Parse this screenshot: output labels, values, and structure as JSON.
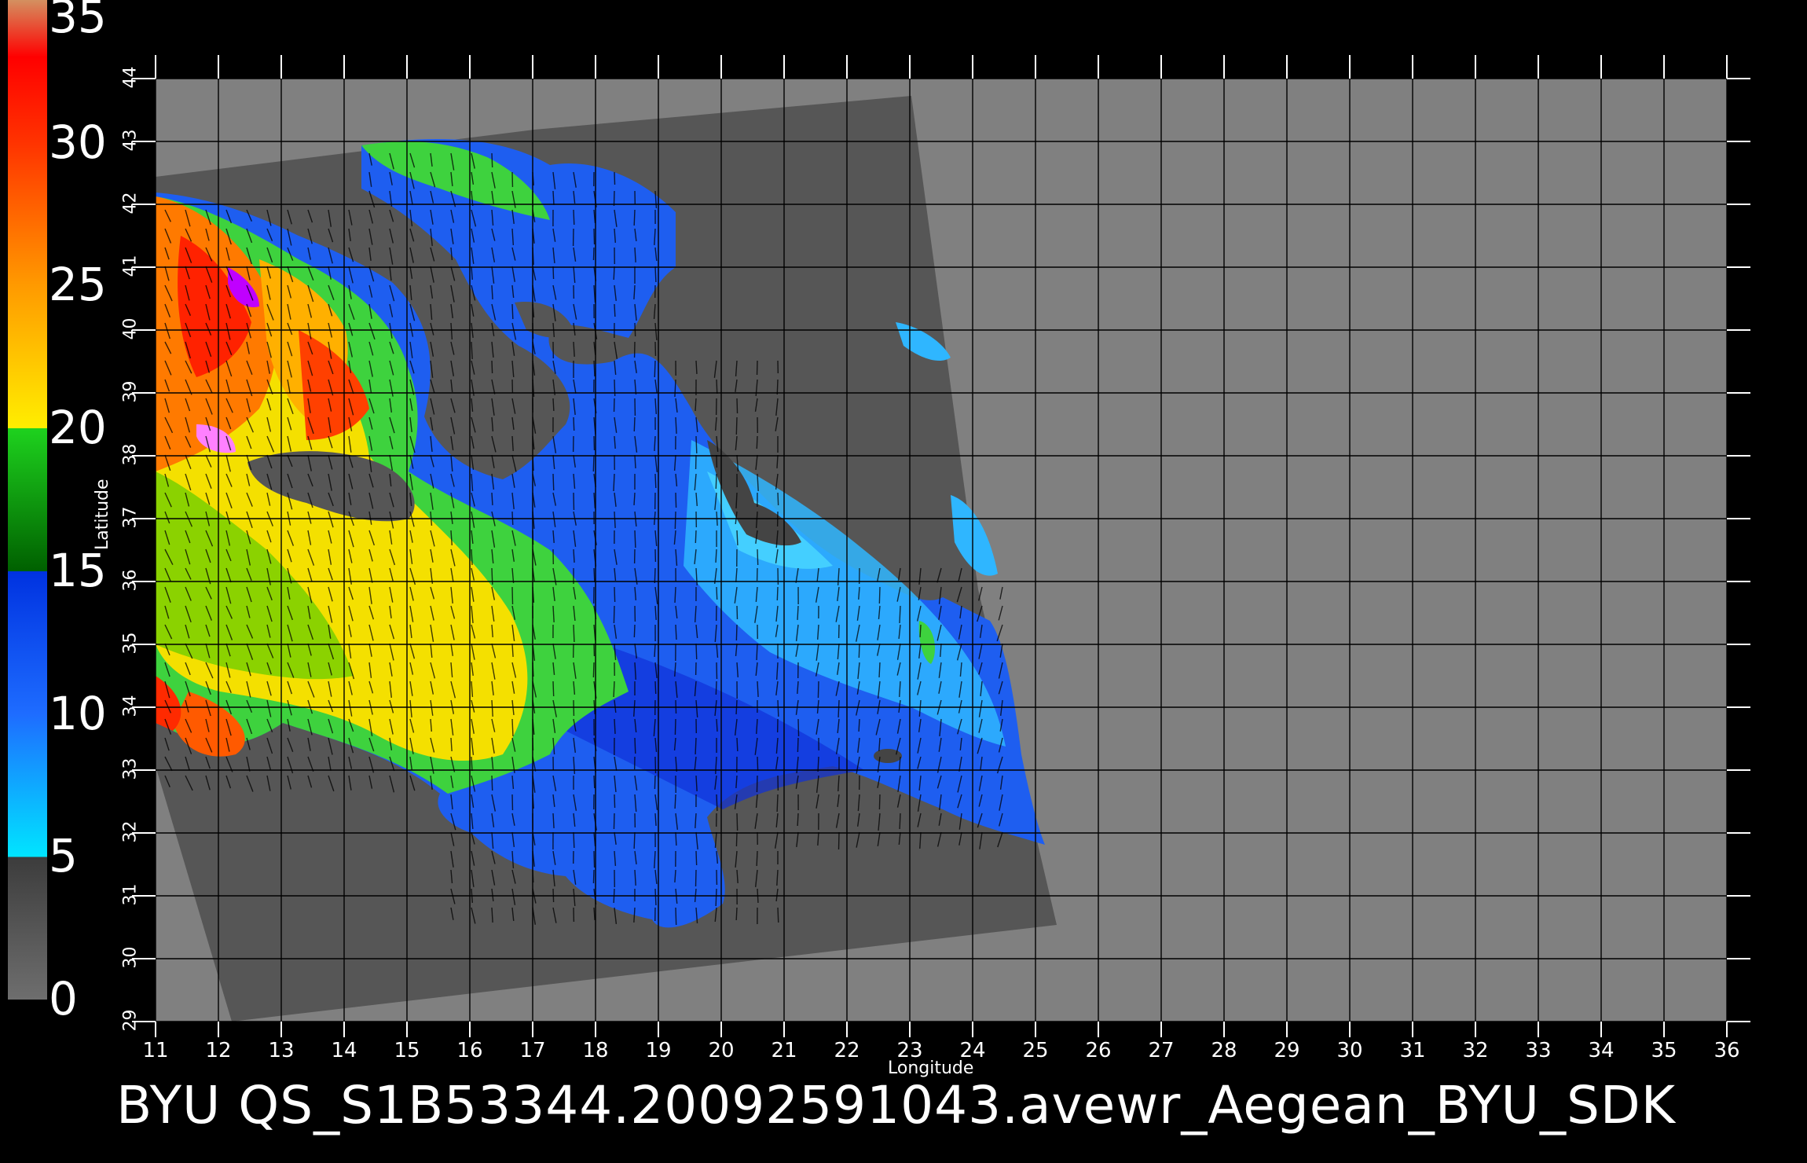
{
  "colorbar": {
    "labels": [
      "35",
      "30",
      "25",
      "20",
      "15",
      "10",
      "5",
      "0"
    ],
    "stops": [
      {
        "value": 0,
        "color": "#6e6e6e"
      },
      {
        "value": 5,
        "color": "#3c3c3c"
      },
      {
        "value": 5,
        "color": "#00e5ff"
      },
      {
        "value": 10,
        "color": "#1e6cff"
      },
      {
        "value": 15,
        "color": "#0032e0"
      },
      {
        "value": 15,
        "color": "#006000"
      },
      {
        "value": 20,
        "color": "#1ed21e"
      },
      {
        "value": 20,
        "color": "#ffee00"
      },
      {
        "value": 25,
        "color": "#ff9a00"
      },
      {
        "value": 30,
        "color": "#ff3300"
      },
      {
        "value": 33,
        "color": "#ff0000"
      },
      {
        "value": 35,
        "color": "#d49060"
      }
    ]
  },
  "axes": {
    "xlabel": "Longitude",
    "ylabel": "Latitude",
    "xlim": [
      11,
      36
    ],
    "ylim": [
      29,
      44
    ],
    "x_ticks": [
      "11",
      "12",
      "13",
      "14",
      "15",
      "16",
      "17",
      "18",
      "19",
      "20",
      "21",
      "22",
      "23",
      "24",
      "25",
      "26",
      "27",
      "28",
      "29",
      "30",
      "31",
      "32",
      "33",
      "34",
      "35",
      "36"
    ],
    "y_ticks": [
      "29",
      "30",
      "31",
      "32",
      "33",
      "34",
      "35",
      "36",
      "37",
      "38",
      "39",
      "40",
      "41",
      "42",
      "43",
      "44"
    ],
    "grid": true
  },
  "caption": "BYU  QS_S1B53344.20092591043.avewr_Aegean_BYU_SDK",
  "colors": {
    "background": "#000000",
    "nodata": "#808080",
    "land": "#555555",
    "grid": "#000000"
  }
}
